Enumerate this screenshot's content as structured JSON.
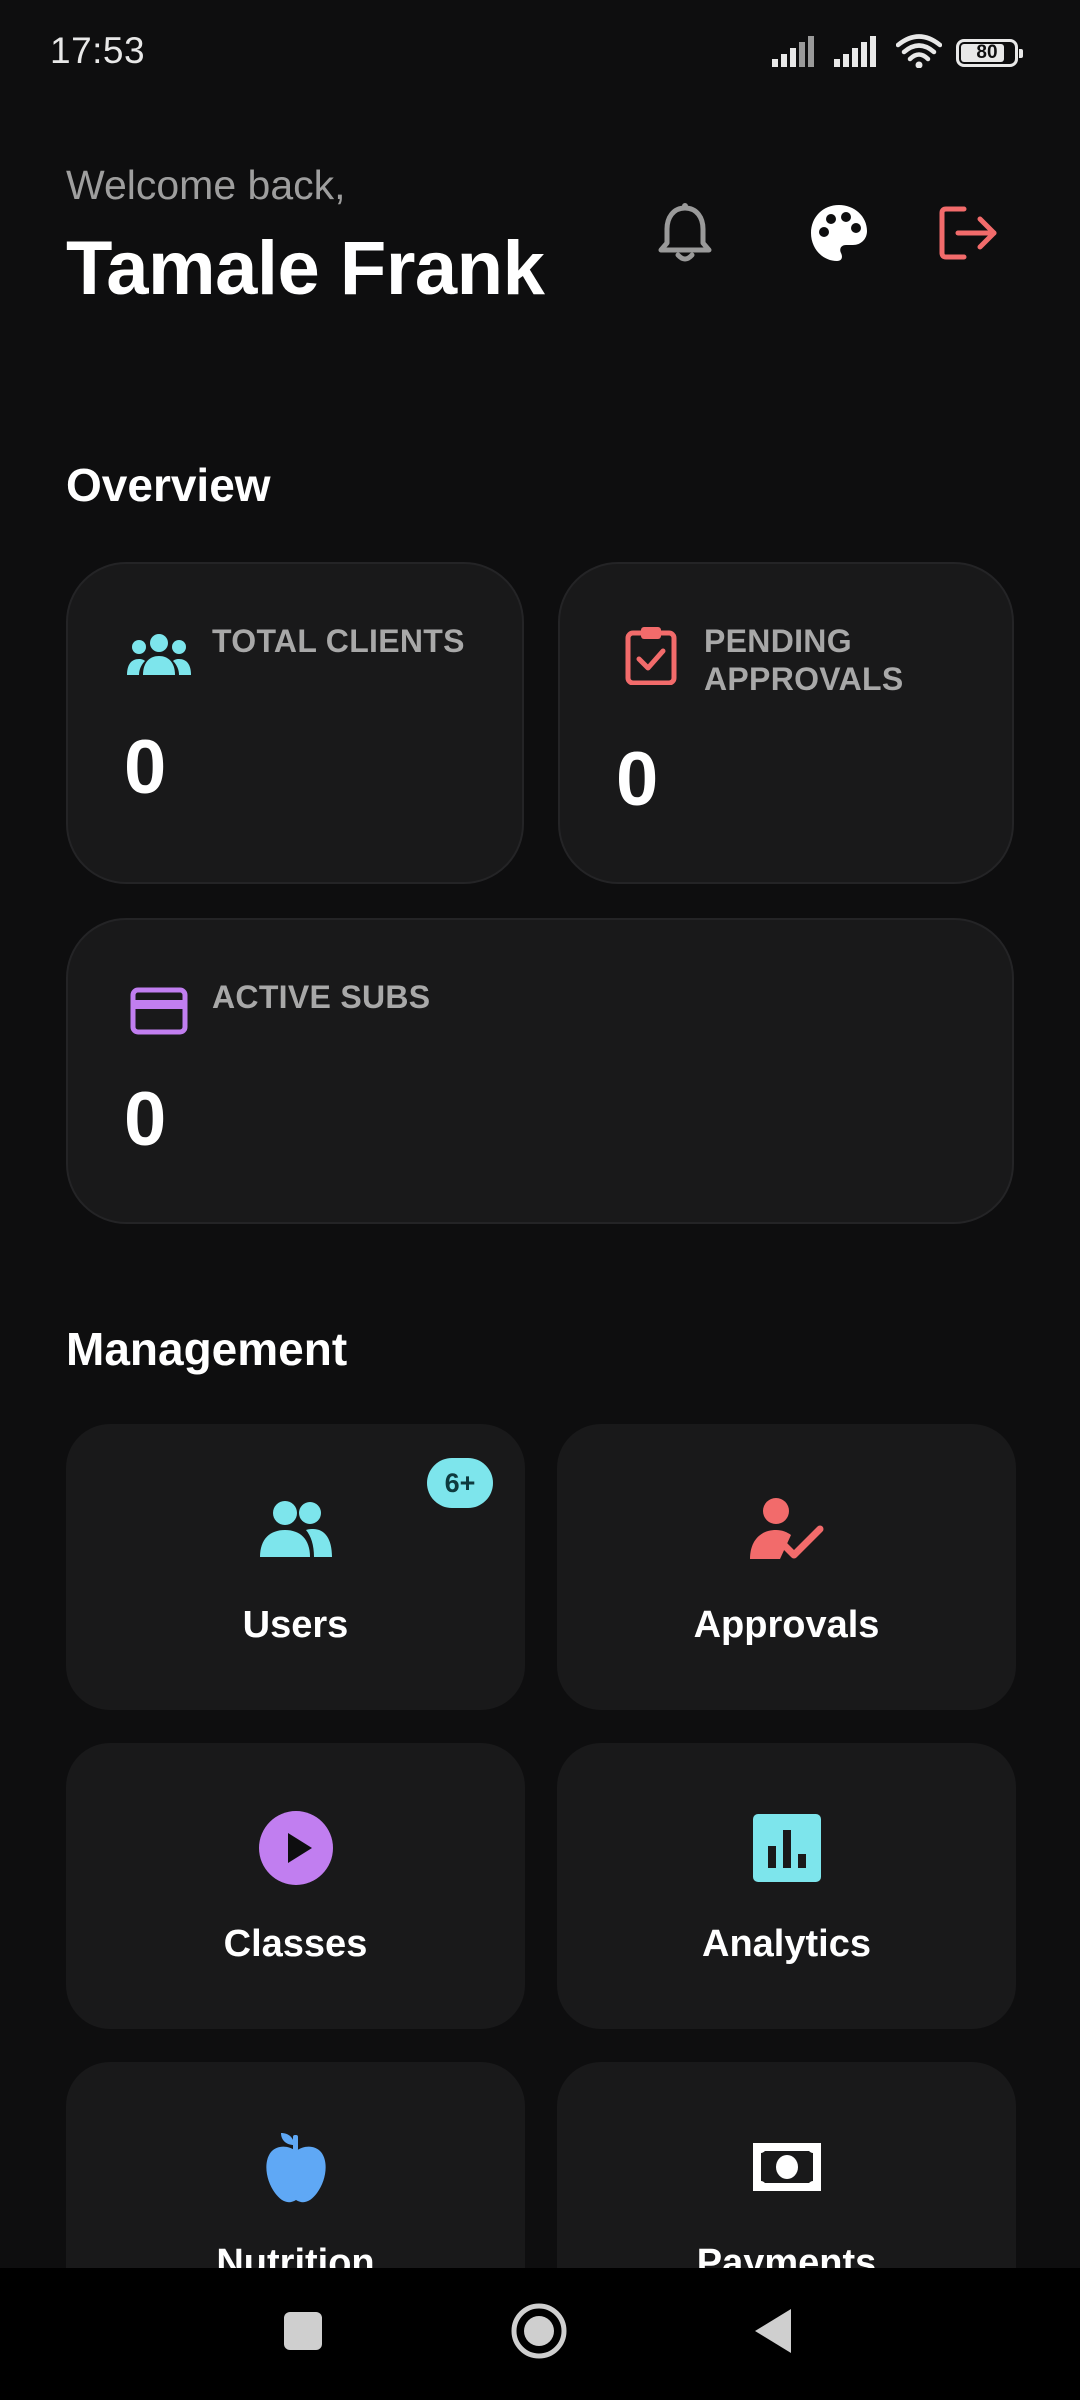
{
  "status_bar": {
    "time": "17:53",
    "battery": "80",
    "icons": [
      "signal-icon",
      "signal-icon",
      "wifi-icon",
      "battery-icon"
    ]
  },
  "header": {
    "welcome": "Welcome back,",
    "user_name": "Tamale Frank",
    "actions": [
      "bell-icon",
      "palette-icon",
      "logout-icon"
    ]
  },
  "overview": {
    "title": "Overview",
    "stats": [
      {
        "label": "TOTAL CLIENTS",
        "value": "0",
        "icon": "users-group-icon",
        "color": "#7de5ec"
      },
      {
        "label_line1": "PENDING",
        "label_line2": "APPROVALS",
        "value": "0",
        "icon": "clipboard-check-icon",
        "color": "#f26b6b"
      },
      {
        "label": "ACTIVE SUBS",
        "value": "0",
        "icon": "credit-card-icon",
        "color": "#c17ef0"
      }
    ]
  },
  "management": {
    "title": "Management",
    "tiles": [
      {
        "label": "Users",
        "icon": "users-icon",
        "color": "#7de5ec",
        "badge": "6+"
      },
      {
        "label": "Approvals",
        "icon": "user-check-icon",
        "color": "#f26b6b"
      },
      {
        "label": "Classes",
        "icon": "play-circle-icon",
        "color": "#c17ef0"
      },
      {
        "label": "Analytics",
        "icon": "bar-chart-icon",
        "color": "#7de5ec"
      },
      {
        "label": "Nutrition",
        "icon": "apple-icon",
        "color": "#5fa8f5"
      },
      {
        "label": "Payments",
        "icon": "banknote-icon",
        "color": "#ffffff"
      }
    ]
  },
  "nav_bar": {
    "buttons": [
      "recents-icon",
      "home-icon",
      "back-icon"
    ]
  }
}
